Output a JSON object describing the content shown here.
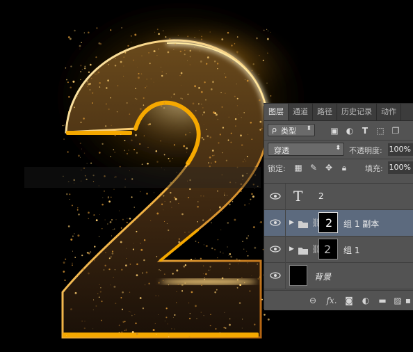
{
  "panel": {
    "tabs": [
      "图层",
      "通道",
      "路径",
      "历史记录",
      "动作"
    ],
    "filter": {
      "kind_label": "类型",
      "search_glyph": "ρ"
    },
    "blend": {
      "mode": "穿透",
      "opacity_label": "不透明度:",
      "opacity_value": "100%"
    },
    "lock": {
      "label": "锁定:",
      "fill_label": "填充:",
      "fill_value": "100%"
    },
    "layers": [
      {
        "name": "2",
        "type": "text",
        "visible": true,
        "selected": false
      },
      {
        "name": "组 1 副本",
        "type": "group",
        "visible": true,
        "selected": true
      },
      {
        "name": "组 1",
        "type": "group",
        "visible": true,
        "selected": false
      },
      {
        "name": "背景",
        "type": "background",
        "visible": true,
        "selected": false
      }
    ],
    "bottom_icons": [
      "link-icon",
      "fx-icon",
      "mask-icon",
      "adjustment-icon",
      "folder-icon",
      "new-layer-icon",
      "trash-icon"
    ],
    "fx_label": "fx."
  },
  "canvas": {
    "big_digit": "2",
    "glow_color": "#f0a020",
    "gold_edge_color": "#f5a800"
  }
}
